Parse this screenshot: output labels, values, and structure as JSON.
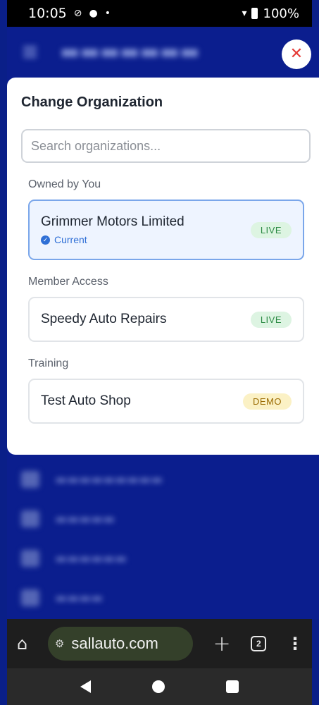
{
  "status_bar": {
    "time": "10:05",
    "battery": "100%"
  },
  "modal": {
    "title": "Change Organization",
    "search_placeholder": "Search organizations...",
    "sections": [
      {
        "label": "Owned by You",
        "orgs": [
          {
            "name": "Grimmer Motors Limited",
            "status": "LIVE",
            "current_label": "Current"
          }
        ]
      },
      {
        "label": "Member Access",
        "orgs": [
          {
            "name": "Speedy Auto Repairs",
            "status": "LIVE"
          }
        ]
      },
      {
        "label": "Training",
        "orgs": [
          {
            "name": "Test Auto Shop",
            "status": "DEMO"
          }
        ]
      }
    ]
  },
  "browser": {
    "url": "sallauto.com",
    "tab_count": "2"
  },
  "colors": {
    "app_background": "#0b1e8e",
    "close_red": "#e53935",
    "live_badge": "#ddf4e2",
    "demo_badge": "#fbf1c5",
    "current_blue": "#2f6fd6"
  }
}
